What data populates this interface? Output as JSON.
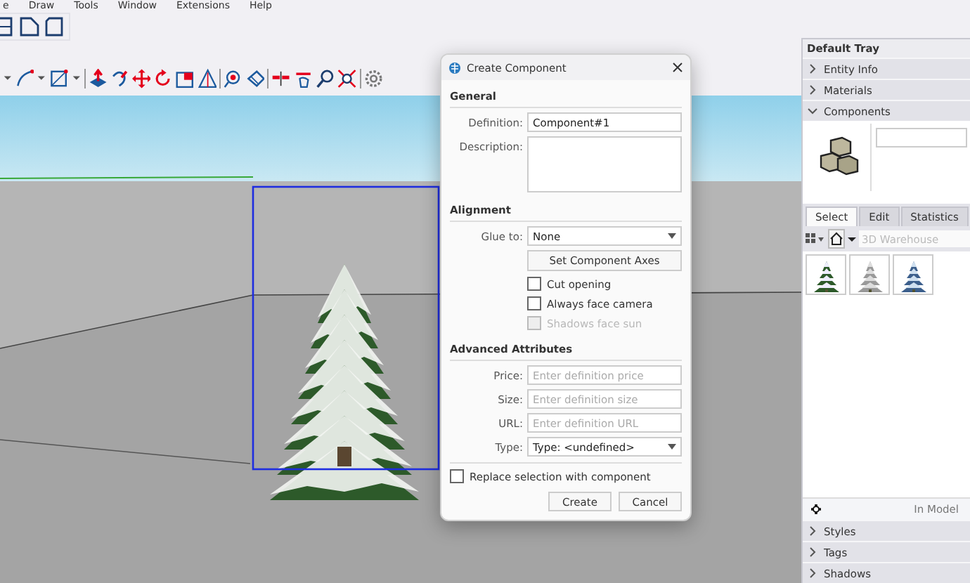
{
  "menu": [
    "e",
    "Draw",
    "Tools",
    "Window",
    "Extensions",
    "Help"
  ],
  "dialog": {
    "title": "Create Component",
    "general": {
      "heading": "General",
      "definition": {
        "label": "Definition:",
        "value": "Component#1"
      },
      "description": {
        "label": "Description:"
      }
    },
    "alignment": {
      "heading": "Alignment",
      "glue_to": {
        "label": "Glue to:",
        "value": "None"
      },
      "axes_button": "Set Component Axes",
      "options": [
        {
          "label": "Cut opening",
          "checked": false,
          "disabled": false
        },
        {
          "label": "Always face camera",
          "checked": false,
          "disabled": false
        },
        {
          "label": "Shadows face sun",
          "checked": false,
          "disabled": true
        }
      ]
    },
    "advanced": {
      "heading": "Advanced Attributes",
      "fields": [
        {
          "kind": "text",
          "label": "Price:",
          "placeholder": "Enter definition price"
        },
        {
          "kind": "text",
          "label": "Size:",
          "placeholder": "Enter definition size"
        },
        {
          "kind": "text",
          "label": "URL:",
          "placeholder": "Enter definition URL"
        },
        {
          "kind": "select",
          "label": "Type:",
          "value": "Type: <undefined>"
        }
      ]
    },
    "replace": {
      "label": "Replace selection with component",
      "checked": false
    },
    "buttons": [
      "Create",
      "Cancel"
    ]
  },
  "tray": {
    "title": "Default Tray",
    "sections": [
      {
        "label": "Entity Info",
        "expanded": false
      },
      {
        "label": "Materials",
        "expanded": false
      },
      {
        "label": "Components",
        "expanded": true
      }
    ],
    "tabs": [
      {
        "label": "Select",
        "selected": true
      },
      {
        "label": "Edit",
        "selected": false
      },
      {
        "label": "Statistics",
        "selected": false
      }
    ],
    "search": {
      "placeholder": "3D Warehouse"
    },
    "footer": "In Model",
    "bottom_sections": [
      {
        "label": "Styles",
        "expanded": false
      },
      {
        "label": "Tags",
        "expanded": false
      },
      {
        "label": "Shadows",
        "expanded": false
      }
    ]
  }
}
